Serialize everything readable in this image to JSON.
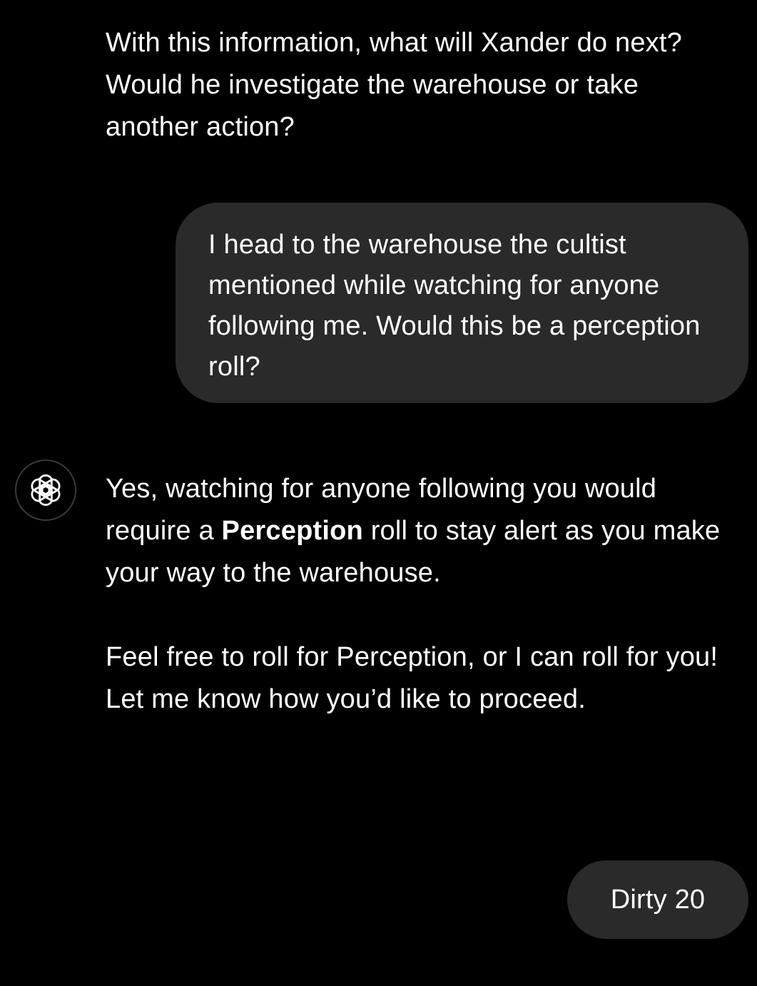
{
  "conversation": {
    "assistant_message_1": "With this information, what will Xander do next? Would he investigate the warehouse or take another action?",
    "user_message_1": "I head to the warehouse the cultist mentioned while watching for anyone following me. Would this be a perception roll?",
    "assistant_message_2": {
      "p1_before": "Yes, watching for anyone following you would require a ",
      "p1_bold": "Perception",
      "p1_after": " roll to stay alert as you make your way to the warehouse.",
      "p2": "Feel free to roll for Perception, or I can roll for you! Let me know how you’d like to proceed."
    },
    "user_message_2": "Dirty 20"
  },
  "assistant_avatar": {
    "icon": "openai-logo-icon"
  },
  "colors": {
    "background": "#000000",
    "user_bubble": "#2a2a2a",
    "text": "#ffffff"
  }
}
